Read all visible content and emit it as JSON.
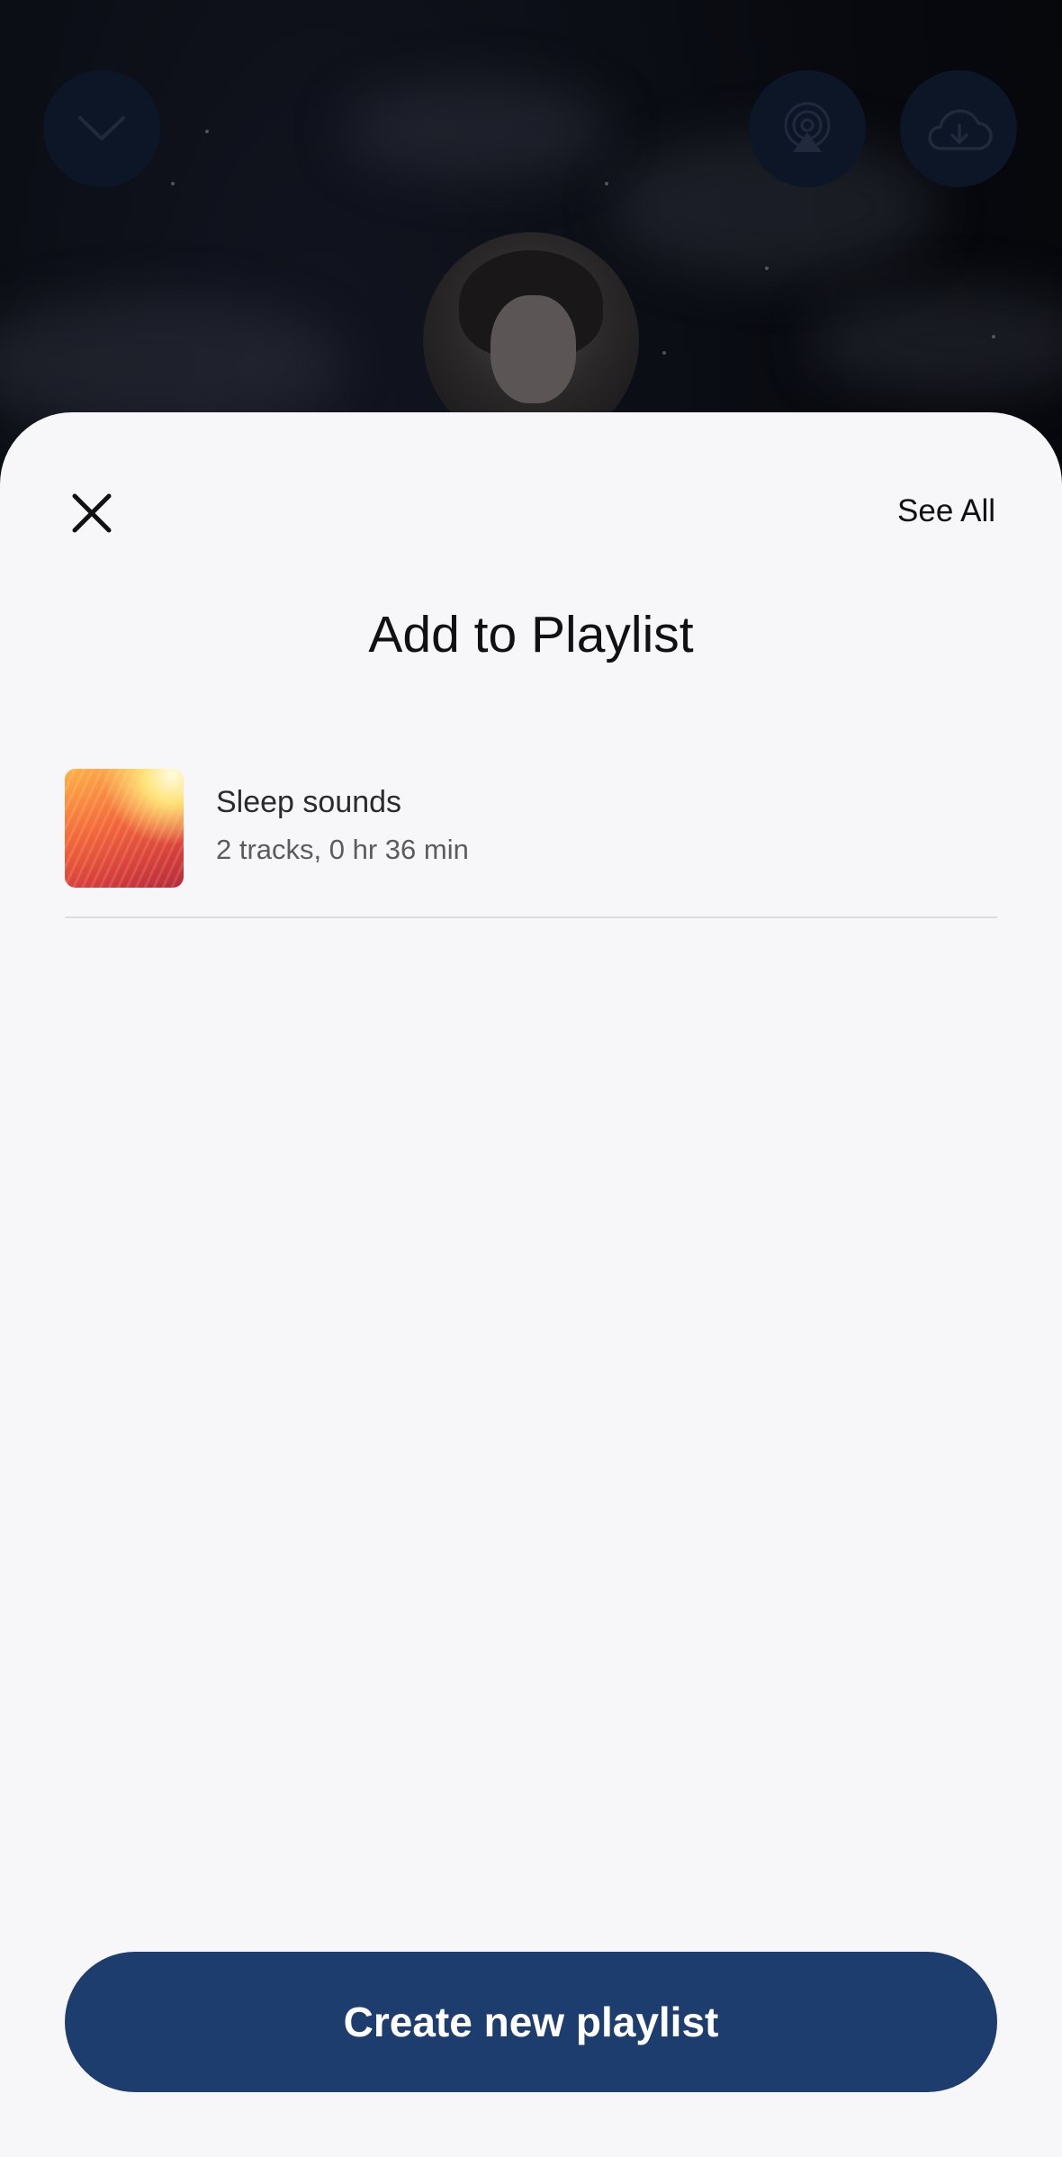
{
  "background": {
    "top_buttons": {
      "collapse_icon": "chevron-down-icon",
      "cast_icon": "airplay-icon",
      "download_icon": "cloud-download-icon"
    },
    "artist_avatar": "artist-photo"
  },
  "sheet": {
    "close_icon": "close-icon",
    "see_all_label": "See All",
    "title": "Add to Playlist",
    "playlists": [
      {
        "name": "Sleep sounds",
        "meta": "2 tracks, 0 hr 36 min"
      }
    ],
    "create_button_label": "Create new playlist"
  },
  "colors": {
    "sheet_background": "#f7f6f9",
    "primary_button": "#1d3d6e",
    "backdrop": "#06080d"
  }
}
